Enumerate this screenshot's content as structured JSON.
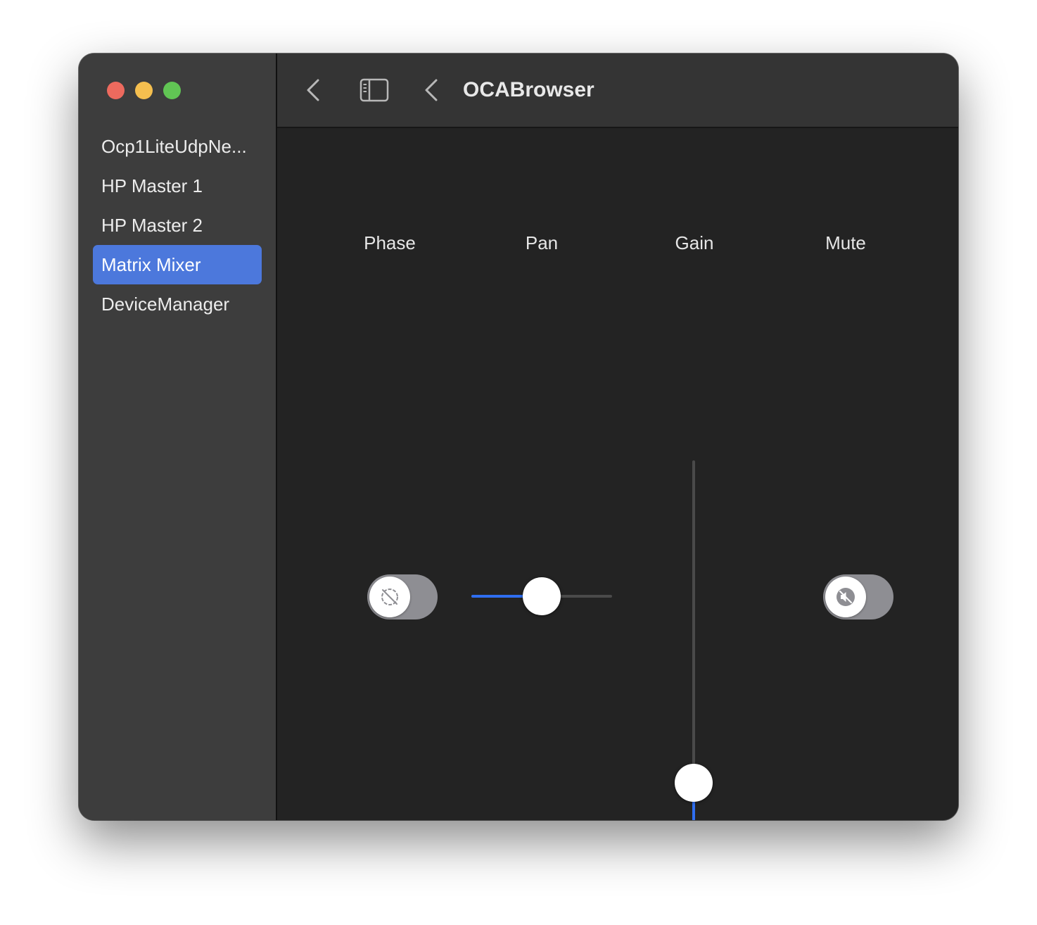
{
  "window": {
    "title": "OCABrowser"
  },
  "sidebar": {
    "items": [
      {
        "label": "Ocp1LiteUdpNe...",
        "selected": false
      },
      {
        "label": "HP Master 1",
        "selected": false
      },
      {
        "label": "HP Master 2",
        "selected": false
      },
      {
        "label": "Matrix Mixer",
        "selected": true
      },
      {
        "label": "DeviceManager",
        "selected": false
      }
    ]
  },
  "toolbar": {
    "back_icon": "chevron-left-icon",
    "sidebar_toggle_icon": "sidebar-toggle-icon",
    "nav_back_icon": "chevron-left-icon"
  },
  "controls": {
    "phase": {
      "label": "Phase",
      "on": false,
      "icon": "phase-invert-icon"
    },
    "pan": {
      "label": "Pan",
      "value_fraction": 0.5
    },
    "gain": {
      "label": "Gain",
      "value_fraction": 0.14
    },
    "mute": {
      "label": "Mute",
      "on": false,
      "icon": "speaker-muted-icon"
    }
  },
  "colors": {
    "accent": "#2f6ef0",
    "selection": "#4c78dc",
    "close": "#ed6a5e",
    "minimize": "#f5bf4f",
    "zoom": "#61c554"
  }
}
